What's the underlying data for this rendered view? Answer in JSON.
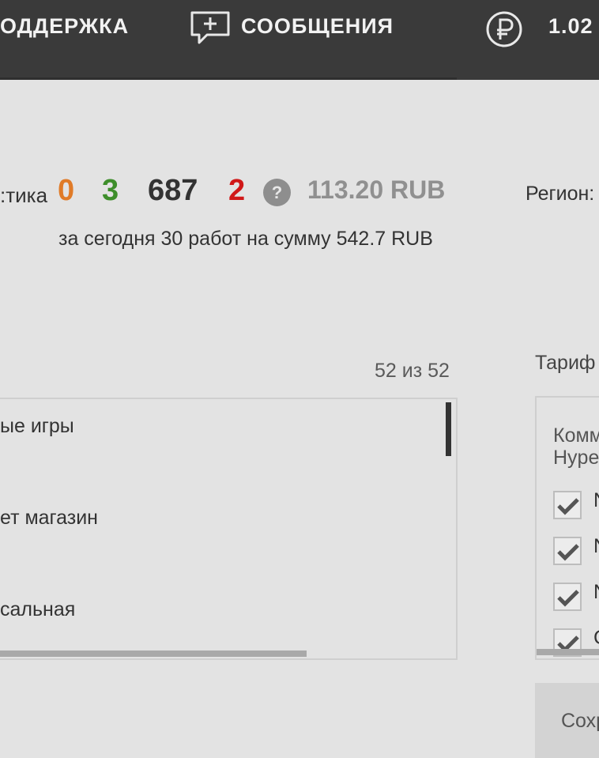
{
  "nav": {
    "support_label": "ОДДЕРЖКА",
    "messages_label": "СООБЩЕНИЯ",
    "balance_value": "1.02",
    "icons": [
      "message-plus-icon",
      "ruble-coin-icon"
    ]
  },
  "stats": {
    "label": "тика:",
    "values": [
      {
        "text": "0",
        "color": "#e07b28"
      },
      {
        "text": "3",
        "color": "#3e8e2b"
      },
      {
        "text": "687",
        "color": "#333333"
      },
      {
        "text": "2",
        "color": "#d01818"
      }
    ],
    "help_symbol": "?",
    "balance": "113.20 RUB",
    "today": "за сегодня 30 работ на сумму 542.7 RUB"
  },
  "region": {
    "label": "Регион:"
  },
  "list": {
    "count": "52 из 52",
    "items": [
      "ые игры",
      "ет магазин",
      "сальная"
    ]
  },
  "tariff": {
    "label": "Тариф",
    "title_line1": "Комм",
    "title_line2": "Hype",
    "options": [
      {
        "label": "N",
        "checked": true
      },
      {
        "label": "N",
        "checked": true
      },
      {
        "label": "N",
        "checked": true
      },
      {
        "label": "C",
        "checked": true
      }
    ]
  },
  "actions": {
    "save_label": "Сохр"
  },
  "colors": {
    "topbar": "#3a3a3a",
    "background": "#e3e3e3",
    "accent_orange": "#e07b28",
    "accent_green": "#3e8e2b",
    "accent_red": "#d01818"
  }
}
